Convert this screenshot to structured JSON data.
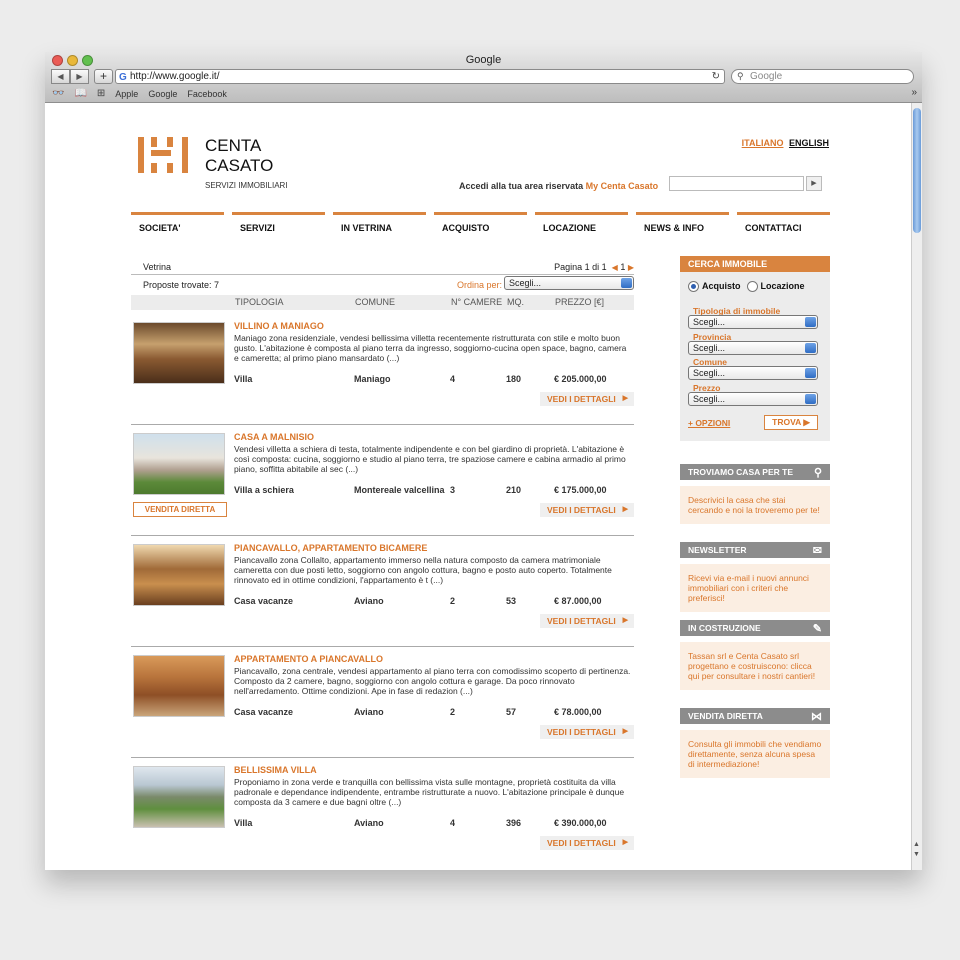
{
  "browser": {
    "title": "Google",
    "url": "http://www.google.it/",
    "search_placeholder": "Google",
    "bookmarks": [
      "Apple",
      "Google",
      "Facebook"
    ]
  },
  "site": {
    "brand_line1": "CENTA",
    "brand_line2": "CASATO",
    "tagline": "SERVIZI IMMOBILIARI",
    "lang_it": "ITALIANO",
    "lang_en": "ENGLISH",
    "login_text": "Accedi alla tua area riservata",
    "login_link": "My Centa Casato",
    "nav": [
      "SOCIETA'",
      "SERVIZI",
      "IN VETRINA",
      "ACQUISTO",
      "LOCAZIONE",
      "NEWS & INFO",
      "CONTATTACI"
    ],
    "breadcrumb": "Vetrina",
    "pagination": "Pagina 1 di 1",
    "page_num": "1",
    "found": "Proposte trovate: 7",
    "order_label": "Ordina per:",
    "order_value": "Scegli...",
    "columns": [
      "TIPOLOGIA",
      "COMUNE",
      "N° CAMERE",
      "MQ.",
      "PREZZO [€]"
    ],
    "details_label": "VEDI I DETTAGLI",
    "direct_sale_label": "VENDITA DIRETTA",
    "listings": [
      {
        "title": "VILLINO A MANIAGO",
        "desc": "Maniago zona residenziale, vendesi bellissima villetta recentemente ristrutturata con stile e molto buon gusto. L'abitazione è composta al piano terra da ingresso, soggiorno-cucina open space, bagno, camera e cameretta; al primo piano mansardato (...)",
        "type": "Villa",
        "city": "Maniago",
        "rooms": "4",
        "sqm": "180",
        "price": "€ 205.000,00"
      },
      {
        "title": "CASA A MALNISIO",
        "desc": "Vendesi villetta a schiera di testa, totalmente indipendente e con bel giardino di proprietà. L'abitazione è così composta: cucina, soggiorno e studio al piano terra, tre spaziose camere e cabina armadio al primo piano, soffitta abitabile al sec (...)",
        "type": "Villa a schiera",
        "city": "Montereale valcellina",
        "rooms": "3",
        "sqm": "210",
        "price": "€ 175.000,00"
      },
      {
        "title": "PIANCAVALLO, APPARTAMENTO BICAMERE",
        "desc": "Piancavallo zona Collalto, appartamento immerso nella natura composto da camera matrimoniale cameretta con due posti letto, soggiorno con angolo cottura, bagno e posto auto coperto. Totalmente rinnovato ed in ottime condizioni, l'appartamento è t (...)",
        "type": "Casa vacanze",
        "city": "Aviano",
        "rooms": "2",
        "sqm": "53",
        "price": "€ 87.000,00"
      },
      {
        "title": "APPARTAMENTO A PIANCAVALLO",
        "desc": "Piancavallo, zona centrale, vendesi appartamento al piano terra con comodissimo scoperto di pertinenza. Composto da 2 camere, bagno, soggiorno con angolo cottura e garage. Da poco rinnovato nell'arredamento. Ottime condizioni. Ape in fase di redazion (...)",
        "type": "Casa vacanze",
        "city": "Aviano",
        "rooms": "2",
        "sqm": "57",
        "price": "€ 78.000,00"
      },
      {
        "title": "BELLISSIMA VILLA",
        "desc": "Proponiamo in zona verde e tranquilla con bellissima vista sulle montagne, proprietà costituita da villa padronale e dependance indipendente, entrambe ristrutturate a nuovo. L'abitazione principale è dunque composta da 3 camere e due bagni oltre (...)",
        "type": "Villa",
        "city": "Aviano",
        "rooms": "4",
        "sqm": "396",
        "price": "€ 390.000,00"
      }
    ],
    "search": {
      "title": "CERCA IMMOBILE",
      "opt_buy": "Acquisto",
      "opt_rent": "Locazione",
      "fields": [
        {
          "label": "Tipologia di immobile",
          "value": "Scegli..."
        },
        {
          "label": "Provincia",
          "value": "Scegli..."
        },
        {
          "label": "Comune",
          "value": "Scegli..."
        },
        {
          "label": "Prezzo",
          "value": "Scegli..."
        }
      ],
      "more": "+ OPZIONI",
      "submit": "TROVA"
    },
    "boxes": [
      {
        "title": "TROVIAMO CASA PER TE",
        "icon": "magnifier-icon",
        "text": "Descrivici la casa che stai cercando e noi la troveremo per te!"
      },
      {
        "title": "NEWSLETTER",
        "icon": "envelope-icon",
        "text": "Ricevi via e-mail i nuovi annunci immobiliari con i criteri che preferisci!"
      },
      {
        "title": "IN COSTRUZIONE",
        "icon": "trowel-icon",
        "text": "Tassan srl e Centa Casato srl progettano e costruiscono: clicca qui per consultare i nostri cantieri!"
      },
      {
        "title": "VENDITA DIRETTA",
        "icon": "handshake-icon",
        "text": "Consulta gli immobili che vendiamo direttamente, senza alcuna spesa di intermediazione!"
      }
    ]
  }
}
